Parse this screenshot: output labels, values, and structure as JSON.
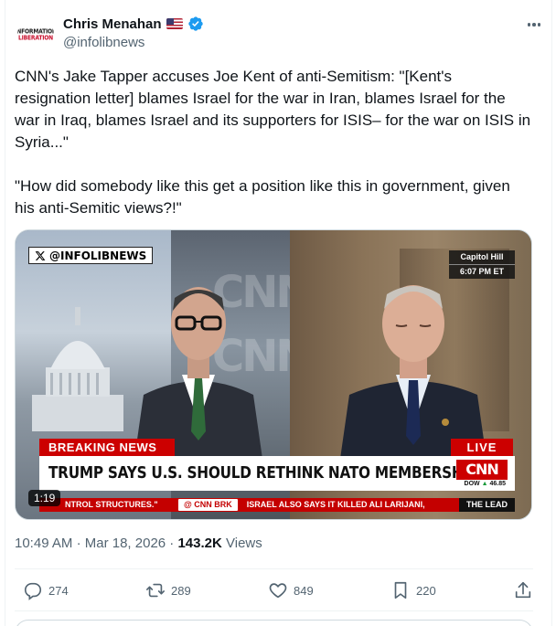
{
  "author": {
    "display_name": "Chris Menahan",
    "handle": "@infolibnews",
    "avatar_text": [
      "INFORMATION",
      "LIBERATION"
    ]
  },
  "tweet": {
    "paragraph_1": "CNN's Jake Tapper accuses Joe Kent of anti-Semitism: \"[Kent's resignation letter] blames Israel for the war in Iran, blames Israel for the war in Iraq, blames Israel and its supporters for ISIS– for the war on ISIS in Syria...\"",
    "paragraph_2": "\"How did somebody like this get a position like this in government, given his anti-Semitic views?!\""
  },
  "media": {
    "watermark": "@INFOLIBNEWS",
    "location": "Capitol Hill",
    "time": "6:07 PM ET",
    "breaking": "BREAKING NEWS",
    "live": "LIVE",
    "headline": "TRUMP SAYS U.S. SHOULD RETHINK NATO MEMBERSHIP",
    "network_logo": "CNN",
    "dow_label": "DOW",
    "dow_value": "46.85",
    "ticker_1": "NTROL STRUCTURES.\"",
    "ticker_brk": "@ CNN BRK",
    "ticker_2": "ISRAEL ALSO SAYS IT KILLED ALI LARIJANI,",
    "ticker_show": "THE LEAD",
    "duration": "1:19"
  },
  "meta": {
    "time": "10:49 AM",
    "separator": "·",
    "date": "Mar 18, 2026",
    "views_count": "143.2K",
    "views_label": "Views"
  },
  "actions": {
    "replies": "274",
    "reposts": "289",
    "likes": "849",
    "bookmarks": "220"
  },
  "colors": {
    "verified": "#1d9bf0",
    "text_secondary": "#536471",
    "cnn_red": "#cc0000"
  }
}
